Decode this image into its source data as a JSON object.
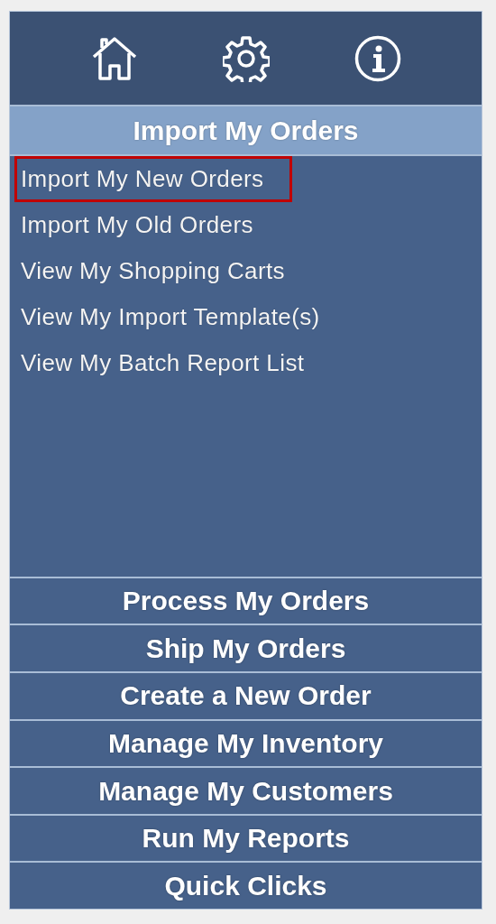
{
  "toolbar": {
    "icons": [
      {
        "kind": "home"
      },
      {
        "kind": "settings"
      },
      {
        "kind": "info"
      }
    ]
  },
  "active_section": {
    "title": "Import My Orders",
    "items": [
      {
        "label": "Import My New Orders",
        "highlighted": true
      },
      {
        "label": "Import My Old Orders",
        "highlighted": false
      },
      {
        "label": "View My Shopping Carts",
        "highlighted": false
      },
      {
        "label": "View My Import Template(s)",
        "highlighted": false
      },
      {
        "label": "View My Batch Report List",
        "highlighted": false
      }
    ]
  },
  "sections": [
    "Process My Orders",
    "Ship My Orders",
    "Create a New Order",
    "Manage My Inventory",
    "Manage My Customers",
    "Run My Reports",
    "Quick Clicks"
  ]
}
